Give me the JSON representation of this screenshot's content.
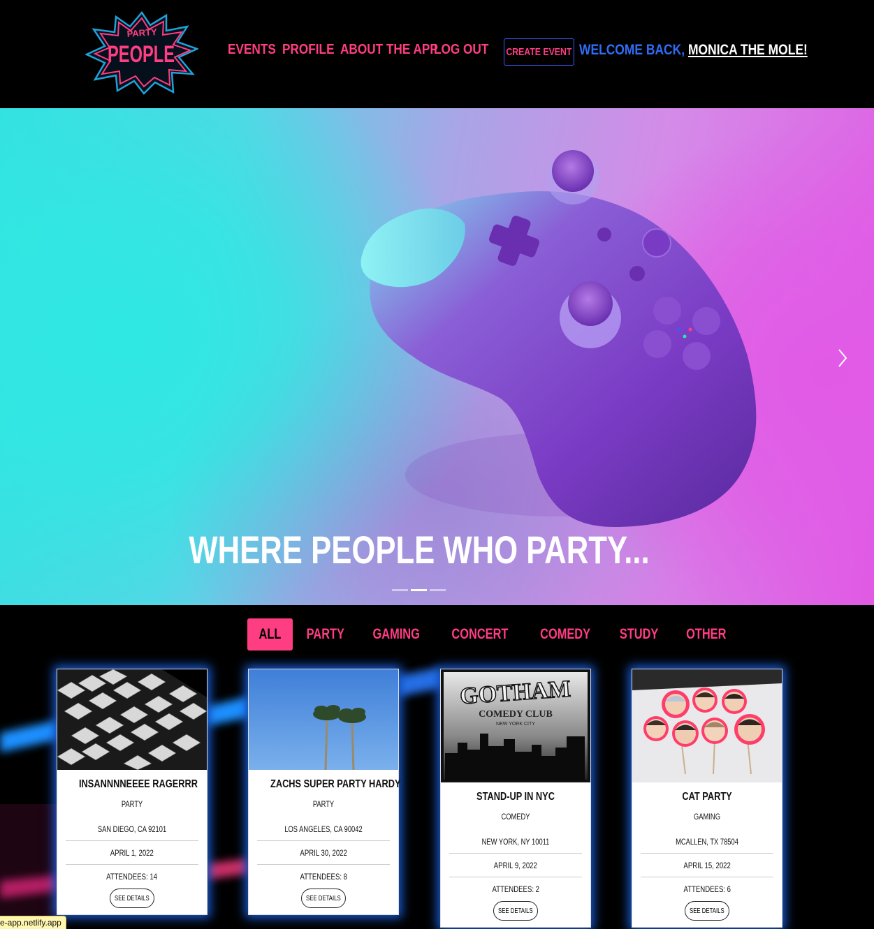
{
  "header": {
    "logo": {
      "top_word": "PARTY",
      "main_word": "PEOPLE"
    },
    "nav": [
      {
        "label": "EVENTS"
      },
      {
        "label": "PROFILE"
      },
      {
        "label": "ABOUT THE APP"
      },
      {
        "label": "LOG OUT"
      }
    ],
    "create_event_label": "CREATE EVENT",
    "welcome_text": "WELCOME BACK,",
    "username": "MONICA THE MOLE!"
  },
  "hero": {
    "caption": "WHERE PEOPLE WHO PARTY...",
    "slides_count": 3,
    "active_slide": 2,
    "next_icon": "chevron-right-icon"
  },
  "filters": {
    "active": "ALL",
    "items": [
      "ALL",
      "PARTY",
      "GAMING",
      "CONCERT",
      "COMEDY",
      "STUDY",
      "OTHER"
    ]
  },
  "events": [
    {
      "title": "INSANNNNEEEE RAGERRR",
      "type": "PARTY",
      "location": "SAN DIEGO, CA 92101",
      "date": "APRIL 1, 2022",
      "attendees": "ATTENDEES: 14",
      "button": "SEE DETAILS"
    },
    {
      "title": "ZACHS SUPER PARTY HARDY",
      "type": "PARTY",
      "location": "LOS ANGELES, CA 90042",
      "date": "APRIL 30, 2022",
      "attendees": "ATTENDEES: 8",
      "button": "SEE DETAILS"
    },
    {
      "title": "STAND-UP IN NYC",
      "type": "COMEDY",
      "location": "NEW YORK, NY 10011",
      "date": "APRIL 9, 2022",
      "attendees": "ATTENDEES: 2",
      "button": "SEE DETAILS",
      "image_text": {
        "line1": "GOTHAM",
        "line2": "COMEDY CLUB",
        "line3": "NEW YORK CITY"
      }
    },
    {
      "title": "CAT PARTY",
      "type": "GAMING",
      "location": "MCALLEN, TX 78504",
      "date": "APRIL 15, 2022",
      "attendees": "ATTENDEES: 6",
      "button": "SEE DETAILS"
    }
  ],
  "status_bar": {
    "url": "e-app.netlify.app"
  },
  "colors": {
    "accent_pink": "#ff3d82",
    "accent_blue": "#2f6df5",
    "glow_blue": "#1e6eff",
    "background": "#000000"
  }
}
